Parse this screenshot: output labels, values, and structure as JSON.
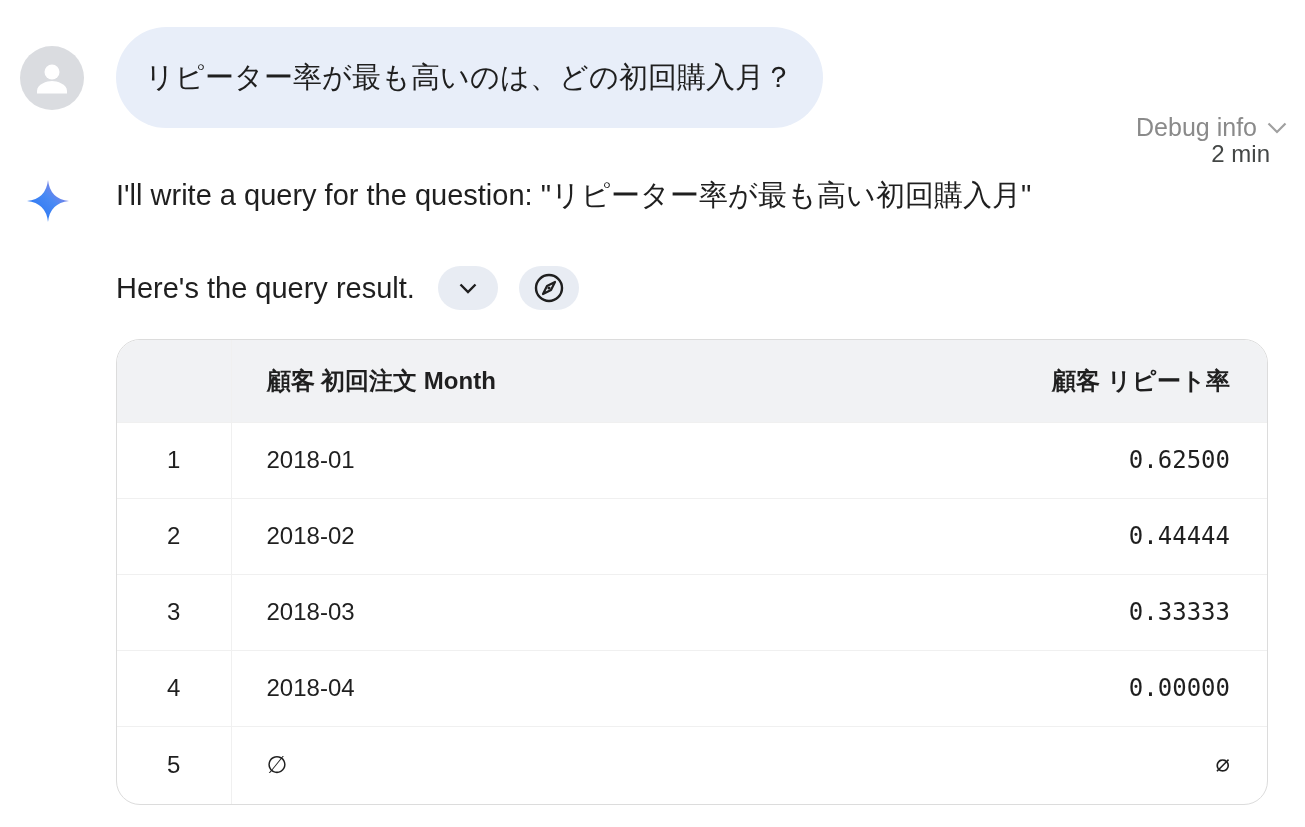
{
  "user_message": {
    "text": "リピーター率が最も高いのは、どの初回購入月？"
  },
  "debug_info": {
    "label": "Debug info",
    "time": "2 min"
  },
  "response": {
    "text": "I'll write a query for the question: \"リピーター率が最も高い初回購入月\"",
    "result_text": "Here's the query result.",
    "table": {
      "columns": [
        {
          "label": "顧客 初回注文 Month",
          "kind": "text"
        },
        {
          "label": "顧客 リピート率",
          "kind": "number"
        }
      ],
      "rows": [
        {
          "number": "1",
          "cells": [
            "2018-01",
            "0.62500"
          ]
        },
        {
          "number": "2",
          "cells": [
            "2018-02",
            "0.44444"
          ]
        },
        {
          "number": "3",
          "cells": [
            "2018-03",
            "0.33333"
          ]
        },
        {
          "number": "4",
          "cells": [
            "2018-04",
            "0.00000"
          ]
        },
        {
          "number": "5",
          "cells": [
            "∅",
            "∅"
          ]
        }
      ]
    }
  }
}
